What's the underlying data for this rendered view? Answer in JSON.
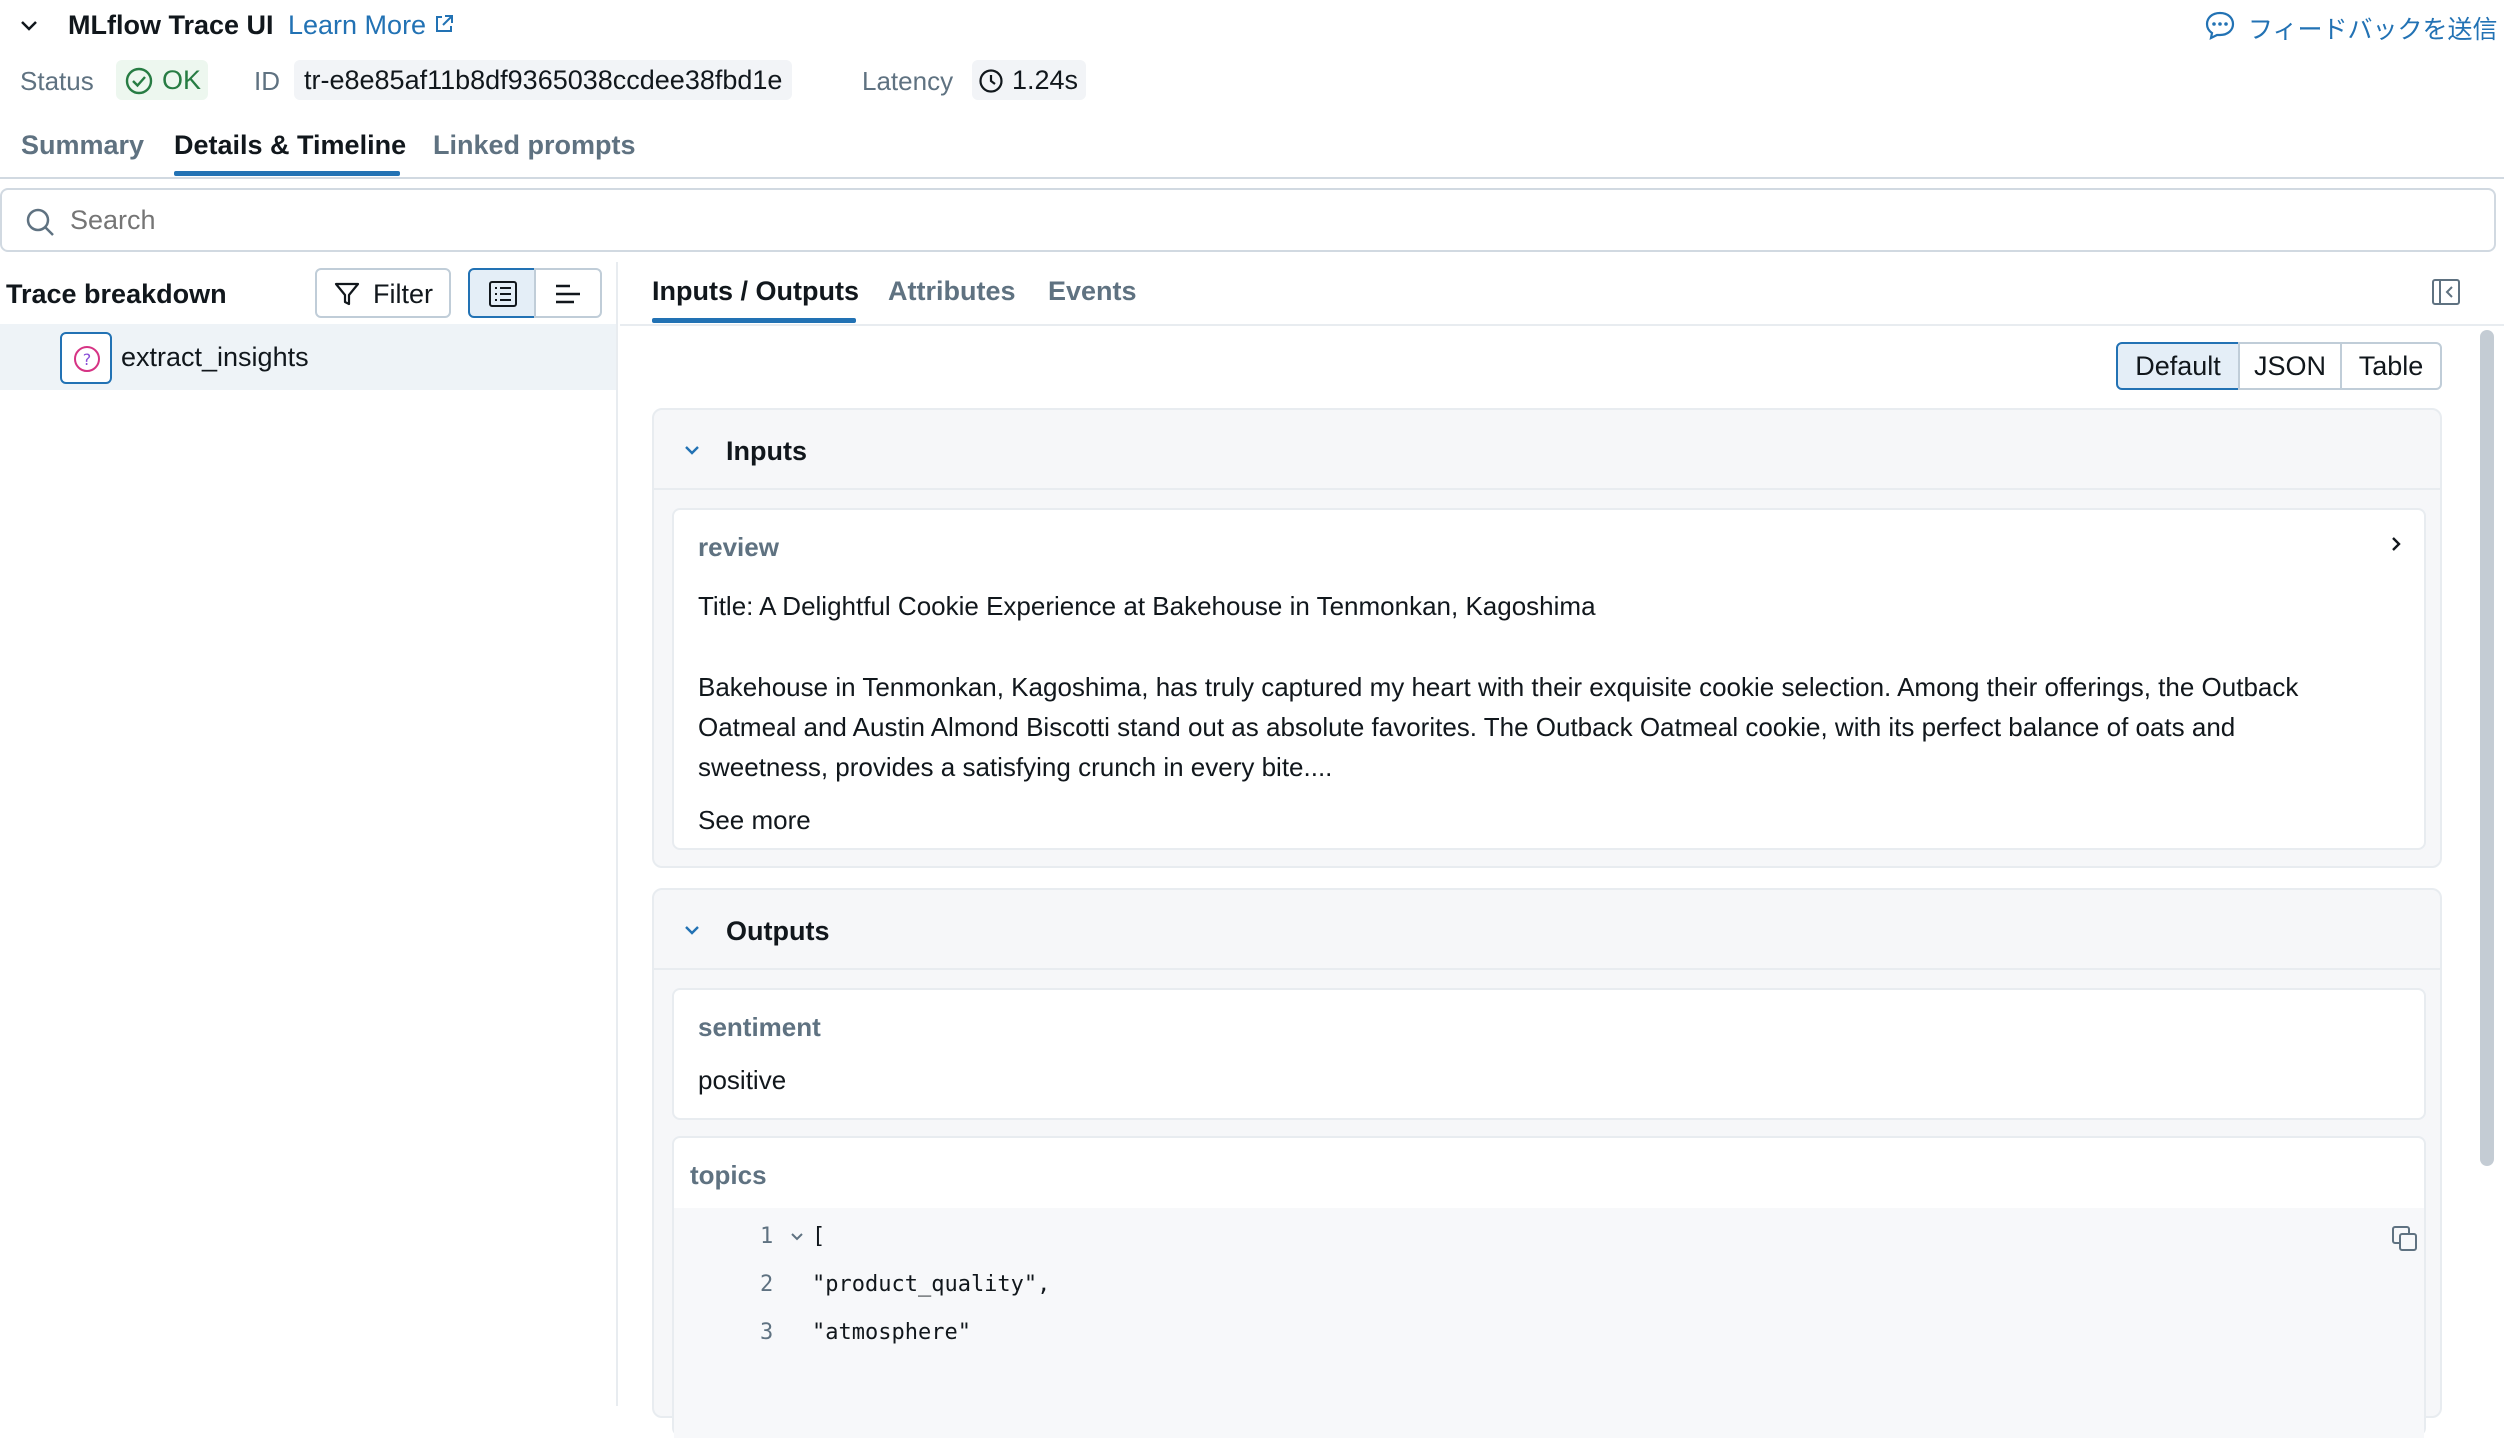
{
  "header": {
    "title": "MLflow Trace UI",
    "learn_more": "Learn More",
    "feedback": "フィードバックを送信",
    "status_label": "Status",
    "status_value": "OK",
    "id_label": "ID",
    "id_value": "tr-e8e85af11b8df9365038ccdee38fbd1e",
    "latency_label": "Latency",
    "latency_value": "1.24s"
  },
  "tabs": [
    {
      "label": "Summary",
      "active": false
    },
    {
      "label": "Details & Timeline",
      "active": true
    },
    {
      "label": "Linked prompts",
      "active": false
    }
  ],
  "search": {
    "placeholder": "Search"
  },
  "left": {
    "title": "Trace breakdown",
    "filter_label": "Filter",
    "nodes": [
      {
        "label": "extract_insights",
        "icon": "question-circle-icon"
      }
    ]
  },
  "right": {
    "tabs": [
      {
        "label": "Inputs / Outputs",
        "active": true
      },
      {
        "label": "Attributes",
        "active": false
      },
      {
        "label": "Events",
        "active": false
      }
    ],
    "view_modes": [
      {
        "label": "Default",
        "active": true
      },
      {
        "label": "JSON",
        "active": false
      },
      {
        "label": "Table",
        "active": false
      }
    ],
    "inputs": {
      "title": "Inputs",
      "field": "review",
      "line1": "Title: A Delightful Cookie Experience at Bakehouse in Tenmonkan, Kagoshima",
      "line2": "Bakehouse in Tenmonkan, Kagoshima, has truly captured my heart with their exquisite cookie selection. Among their offerings, the Outback",
      "line3": "Oatmeal and Austin Almond Biscotti stand out as absolute favorites. The Outback Oatmeal cookie, with its perfect balance of oats and",
      "line4": "sweetness, provides a satisfying crunch in every bite....",
      "see_more": "See more"
    },
    "outputs": {
      "title": "Outputs",
      "sentiment_label": "sentiment",
      "sentiment_value": "positive",
      "topics_label": "topics",
      "code_lines": [
        {
          "n": "1",
          "text": "["
        },
        {
          "n": "2",
          "text": "\"product_quality\","
        },
        {
          "n": "3",
          "text": "\"atmosphere\""
        }
      ]
    }
  },
  "colors": {
    "accent": "#2272b4",
    "ok_green": "#277c43",
    "selected_bg": "#eef3f7"
  }
}
